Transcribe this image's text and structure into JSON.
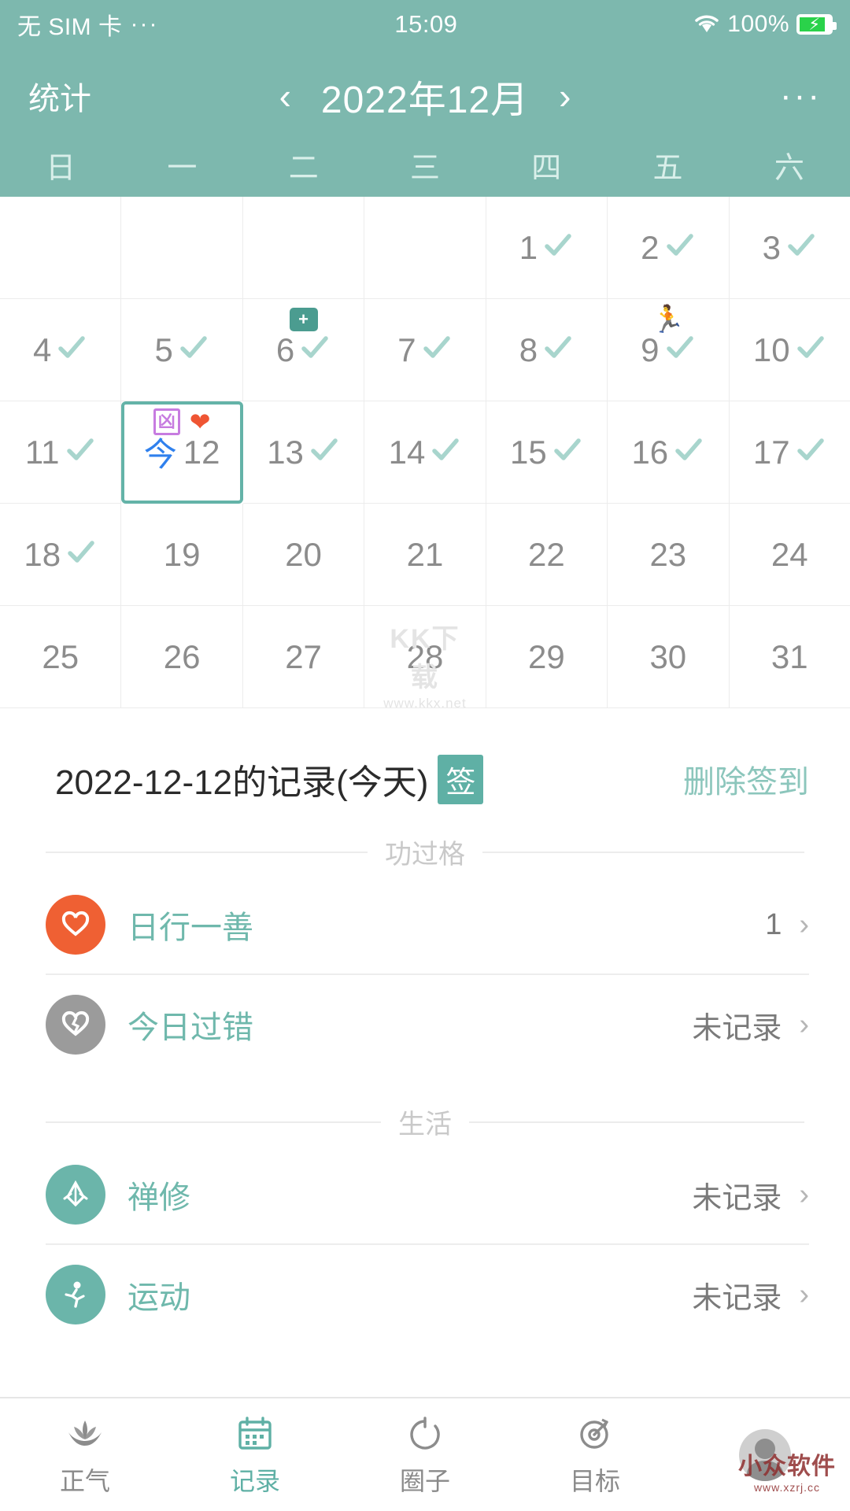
{
  "status_bar": {
    "carrier": "无 SIM 卡",
    "carrier_dots": "···",
    "time": "15:09",
    "battery_percent": "100%",
    "wifi_icon": "wifi-icon",
    "battery_icon": "battery-charging-icon"
  },
  "app_bar": {
    "left_label": "统计",
    "prev_icon": "chevron-left-icon",
    "title": "2022年12月",
    "next_icon": "chevron-right-icon",
    "overflow_label": "···"
  },
  "weekdays": [
    "日",
    "一",
    "二",
    "三",
    "四",
    "五",
    "六"
  ],
  "calendar": {
    "selected_day": "12",
    "today_prefix": "今",
    "check_icon": "check-icon",
    "rows": [
      [
        {
          "day": "",
          "checked": false,
          "badges": []
        },
        {
          "day": "",
          "checked": false,
          "badges": []
        },
        {
          "day": "",
          "checked": false,
          "badges": []
        },
        {
          "day": "",
          "checked": false,
          "badges": []
        },
        {
          "day": "1",
          "checked": true,
          "badges": []
        },
        {
          "day": "2",
          "checked": true,
          "badges": []
        },
        {
          "day": "3",
          "checked": true,
          "badges": []
        }
      ],
      [
        {
          "day": "4",
          "checked": true,
          "badges": []
        },
        {
          "day": "5",
          "checked": true,
          "badges": []
        },
        {
          "day": "6",
          "checked": true,
          "badges": [
            "medkit-icon"
          ]
        },
        {
          "day": "7",
          "checked": true,
          "badges": []
        },
        {
          "day": "8",
          "checked": true,
          "badges": []
        },
        {
          "day": "9",
          "checked": true,
          "badges": [
            "runner-icon"
          ]
        },
        {
          "day": "10",
          "checked": true,
          "badges": []
        }
      ],
      [
        {
          "day": "11",
          "checked": true,
          "badges": []
        },
        {
          "day": "12",
          "checked": false,
          "selected": true,
          "today": true,
          "badges": [
            "xiong-icon",
            "heart-icon"
          ]
        },
        {
          "day": "13",
          "checked": true,
          "badges": []
        },
        {
          "day": "14",
          "checked": true,
          "badges": []
        },
        {
          "day": "15",
          "checked": true,
          "badges": []
        },
        {
          "day": "16",
          "checked": true,
          "badges": []
        },
        {
          "day": "17",
          "checked": true,
          "badges": []
        }
      ],
      [
        {
          "day": "18",
          "checked": true,
          "badges": []
        },
        {
          "day": "19",
          "checked": false,
          "badges": []
        },
        {
          "day": "20",
          "checked": false,
          "badges": []
        },
        {
          "day": "21",
          "checked": false,
          "badges": []
        },
        {
          "day": "22",
          "checked": false,
          "badges": []
        },
        {
          "day": "23",
          "checked": false,
          "badges": []
        },
        {
          "day": "24",
          "checked": false,
          "badges": []
        }
      ],
      [
        {
          "day": "25",
          "checked": false,
          "badges": []
        },
        {
          "day": "26",
          "checked": false,
          "badges": []
        },
        {
          "day": "27",
          "checked": false,
          "badges": []
        },
        {
          "day": "28",
          "checked": false,
          "badges": []
        },
        {
          "day": "29",
          "checked": false,
          "badges": []
        },
        {
          "day": "30",
          "checked": false,
          "badges": []
        },
        {
          "day": "31",
          "checked": false,
          "badges": []
        }
      ]
    ],
    "watermark": {
      "line1": "KK下载",
      "line2": "www.kkx.net"
    }
  },
  "record": {
    "title": "2022-12-12的记录(今天)",
    "sign_badge": "签",
    "delete_action": "删除签到"
  },
  "sections": [
    {
      "label": "功过格",
      "items": [
        {
          "icon": "heart-filled-icon",
          "icon_color": "#ef6033",
          "label": "日行一善",
          "value": "1"
        },
        {
          "icon": "heart-broken-icon",
          "icon_color": "#9b9b9b",
          "label": "今日过错",
          "value": "未记录"
        }
      ]
    },
    {
      "label": "生活",
      "items": [
        {
          "icon": "praying-hands-icon",
          "icon_color": "#6bb5aa",
          "label": "禅修",
          "value": "未记录"
        },
        {
          "icon": "exercise-icon",
          "icon_color": "#6bb5aa",
          "label": "运动",
          "value": "未记录"
        }
      ]
    }
  ],
  "bottom_nav": [
    {
      "icon": "lotus-icon",
      "label": "正气",
      "active": false
    },
    {
      "icon": "calendar-icon",
      "label": "记录",
      "active": true
    },
    {
      "icon": "circle-refresh-icon",
      "label": "圈子",
      "active": false
    },
    {
      "icon": "target-icon",
      "label": "目标",
      "active": false
    },
    {
      "icon": "avatar-icon",
      "label": "",
      "active": false
    }
  ],
  "bottom_watermark": {
    "line1": "小众软件",
    "line2": "www.xzrj.cc"
  },
  "colors": {
    "brand": "#7db8ae",
    "accent": "#5fb0a5",
    "check": "#a8d5cd",
    "today_blue": "#2f80ed",
    "good_orange": "#ef6033"
  }
}
